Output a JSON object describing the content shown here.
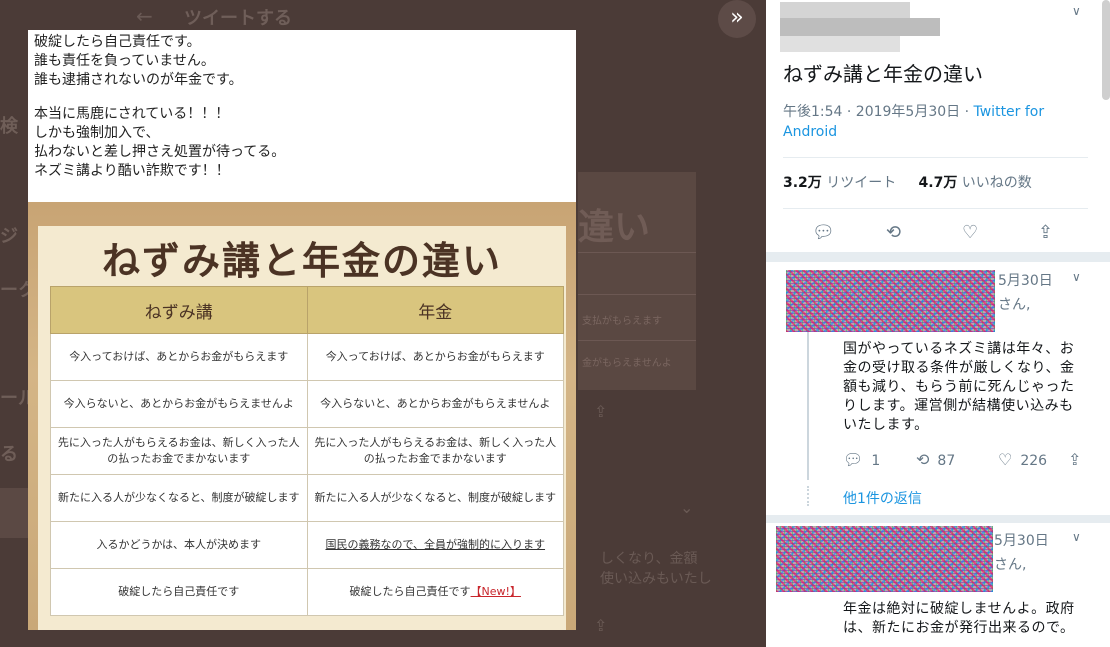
{
  "background": {
    "header_title": "ツイートする",
    "side_fragments": [
      "検",
      "ジ",
      "ーク",
      "ール",
      "る"
    ],
    "card_big": "違い",
    "card_lines": [
      "支払がもらえます",
      "金がもらえませんよ"
    ],
    "fragment_1": "しくなり、金額",
    "fragment_2": "使い込みもいたし"
  },
  "photo": {
    "caption_lines": [
      "破綻したら自己責任です。",
      "誰も責任を負っていません。",
      "誰も逮捕されないのが年金です。",
      "本当に馬鹿にされている！！！",
      "しかも強制加入で、",
      "払わないと差し押さえ処置が待ってる。",
      "ネズミ講より酷い詐欺です！！"
    ],
    "poster_title": "ねずみ講と年金の違い",
    "table": {
      "headers": [
        "ねずみ講",
        "年金"
      ],
      "rows": [
        [
          "今入っておけば、あとからお金がもらえます",
          "今入っておけば、あとからお金がもらえます"
        ],
        [
          "今入らないと、あとからお金がもらえませんよ",
          "今入らないと、あとからお金がもらえませんよ"
        ],
        [
          "先に入った人がもらえるお金は、新しく入った人の払ったお金でまかないます",
          "先に入った人がもらえるお金は、新しく入った人の払ったお金でまかないます"
        ],
        [
          "新たに入る人が少なくなると、制度が破綻します",
          "新たに入る人が少なくなると、制度が破綻します"
        ],
        [
          "入るかどうかは、本人が決めます",
          "国民の義務なので、全員が強制的に入ります"
        ],
        [
          "破綻したら自己責任です",
          "破綻したら自己責任です"
        ]
      ],
      "new_tag": "【New!】"
    }
  },
  "panel": {
    "tweet_title": "ねずみ講と年金の違い",
    "time": "午後1:54 · 2019年5月30日 · ",
    "via": "Twitter for Android",
    "retweet_count": "3.2万",
    "retweet_label": "リツイート",
    "like_count": "4.7万",
    "like_label": "いいねの数",
    "replies": [
      {
        "date": "5月30日",
        "to": "さん,",
        "text": [
          "国がやっているネズミ講は年々、お",
          "金の受け取る条件が厳しくなり、金",
          "額も減り、もらう前に死んじゃった",
          "りします。運営側が結構使い込みも",
          "いたします。"
        ],
        "reply_count": "1",
        "retweet_count": "87",
        "like_count": "226",
        "more_replies": "他1件の返信"
      },
      {
        "date": "5月30日",
        "to": "さん,",
        "text": [
          "年金は絶対に破綻しませんよ。政府",
          "は、新たにお金が発行出来るので。"
        ]
      }
    ]
  }
}
